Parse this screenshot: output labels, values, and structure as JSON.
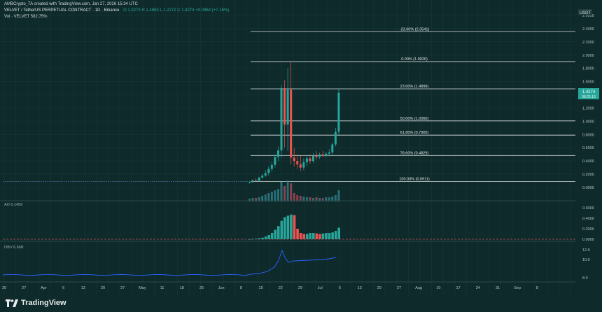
{
  "header": {
    "credit": "AMBCrypto_TA created with TradingView.com, Jan 27, 2026 15:34 UTC",
    "symbol": "VELVET / TetherUS PERPETUAL CONTRACT · 1D · Binance",
    "ohlc": "O 1.3273  H 1.4863  L 1.2272  C 1.4274  +0.0964 (+7.16%)",
    "volume": "Vol · VELVET  582.75%",
    "currency": "USDT",
    "price_tag": "1.4274",
    "price_tag_sub": "08:25:16"
  },
  "brand": {
    "logo_text": "TradingView",
    "logo_icon": "tradingview-logo-icon"
  },
  "colors": {
    "background": "#0f2a2b",
    "up": "#26a69a",
    "down": "#ef5350",
    "fib": "#d8dede",
    "obv": "#2962ff"
  },
  "price_axis": [
    "2.6000",
    "2.4000",
    "2.2000",
    "2.0000",
    "1.8000",
    "1.6000",
    "1.4000",
    "1.2000",
    "1.0000",
    "0.8000",
    "0.6000",
    "0.4000",
    "0.2000",
    "0.0000"
  ],
  "ao_axis": [
    "0.6000",
    "0.4000",
    "0.2000",
    "0.0000"
  ],
  "obv_axis": [
    "12.0",
    "10.0",
    "8.0"
  ],
  "ao_label": "AO  0.1456",
  "obv_label": "OBV  6.66B",
  "time_axis": [
    "20",
    "27",
    "Apr",
    "6",
    "13",
    "20",
    "27",
    "May",
    "11",
    "18",
    "25",
    "Jun",
    "8",
    "15",
    "22",
    "29",
    "Jul",
    "6",
    "13",
    "20",
    "27",
    "Aug",
    "10",
    "17",
    "24",
    "31",
    "Sep",
    "8"
  ],
  "fib_levels": [
    {
      "label": "-23.60% (2.3541)",
      "price": 2.3541
    },
    {
      "label": "0.00% (1.9020)",
      "price": 1.902
    },
    {
      "label": "23.60% (1.4899)",
      "price": 1.4899
    },
    {
      "label": "50.00% (1.0060)",
      "price": 1.006
    },
    {
      "label": "61.80% (0.7905)",
      "price": 0.7905
    },
    {
      "label": "78.60% (0.4829)",
      "price": 0.4829
    },
    {
      "label": "100.00% (0.0911)",
      "price": 0.0911
    }
  ],
  "chart_data": {
    "type": "candlestick",
    "y_range": [
      0,
      2.6
    ],
    "candles": [
      {
        "o": 0.07,
        "h": 0.1,
        "l": 0.06,
        "c": 0.08
      },
      {
        "o": 0.08,
        "h": 0.12,
        "l": 0.07,
        "c": 0.11
      },
      {
        "o": 0.11,
        "h": 0.14,
        "l": 0.09,
        "c": 0.1
      },
      {
        "o": 0.1,
        "h": 0.16,
        "l": 0.09,
        "c": 0.15
      },
      {
        "o": 0.15,
        "h": 0.2,
        "l": 0.13,
        "c": 0.18
      },
      {
        "o": 0.18,
        "h": 0.26,
        "l": 0.16,
        "c": 0.22
      },
      {
        "o": 0.22,
        "h": 0.32,
        "l": 0.18,
        "c": 0.28
      },
      {
        "o": 0.28,
        "h": 0.38,
        "l": 0.24,
        "c": 0.34
      },
      {
        "o": 0.34,
        "h": 0.5,
        "l": 0.3,
        "c": 0.46
      },
      {
        "o": 0.46,
        "h": 0.62,
        "l": 0.4,
        "c": 0.56
      },
      {
        "o": 0.56,
        "h": 1.55,
        "l": 0.45,
        "c": 1.5
      },
      {
        "o": 1.5,
        "h": 1.62,
        "l": 0.6,
        "c": 0.95
      },
      {
        "o": 0.95,
        "h": 1.8,
        "l": 0.55,
        "c": 1.48
      },
      {
        "o": 1.48,
        "h": 1.9,
        "l": 0.35,
        "c": 0.45
      },
      {
        "o": 0.45,
        "h": 0.6,
        "l": 0.32,
        "c": 0.4
      },
      {
        "o": 0.4,
        "h": 0.5,
        "l": 0.28,
        "c": 0.35
      },
      {
        "o": 0.35,
        "h": 0.48,
        "l": 0.25,
        "c": 0.3
      },
      {
        "o": 0.3,
        "h": 0.44,
        "l": 0.26,
        "c": 0.38
      },
      {
        "o": 0.38,
        "h": 0.48,
        "l": 0.32,
        "c": 0.44
      },
      {
        "o": 0.44,
        "h": 0.5,
        "l": 0.36,
        "c": 0.4
      },
      {
        "o": 0.4,
        "h": 0.52,
        "l": 0.37,
        "c": 0.48
      },
      {
        "o": 0.48,
        "h": 0.55,
        "l": 0.42,
        "c": 0.46
      },
      {
        "o": 0.46,
        "h": 0.53,
        "l": 0.43,
        "c": 0.5
      },
      {
        "o": 0.5,
        "h": 0.55,
        "l": 0.46,
        "c": 0.48
      },
      {
        "o": 0.48,
        "h": 0.54,
        "l": 0.45,
        "c": 0.51
      },
      {
        "o": 0.51,
        "h": 0.58,
        "l": 0.47,
        "c": 0.53
      },
      {
        "o": 0.53,
        "h": 0.68,
        "l": 0.5,
        "c": 0.65
      },
      {
        "o": 0.65,
        "h": 0.9,
        "l": 0.62,
        "c": 0.84
      },
      {
        "o": 0.84,
        "h": 1.49,
        "l": 0.8,
        "c": 1.43
      }
    ],
    "ao_values": [
      0.0,
      0.01,
      0.01,
      0.02,
      0.03,
      0.05,
      0.08,
      0.12,
      0.18,
      0.25,
      0.35,
      0.42,
      0.45,
      0.47,
      0.46,
      0.2,
      0.12,
      0.1,
      0.1,
      0.12,
      0.12,
      0.11,
      0.1,
      0.11,
      0.12,
      0.12,
      0.13,
      0.16,
      0.22
    ],
    "volume_values": [
      0.04,
      0.05,
      0.05,
      0.06,
      0.08,
      0.1,
      0.12,
      0.14,
      0.16,
      0.18,
      0.28,
      0.22,
      0.3,
      0.26,
      0.12,
      0.09,
      0.08,
      0.07,
      0.06,
      0.06,
      0.05,
      0.06,
      0.05,
      0.05,
      0.06,
      0.06,
      0.07,
      0.09,
      0.16
    ]
  }
}
